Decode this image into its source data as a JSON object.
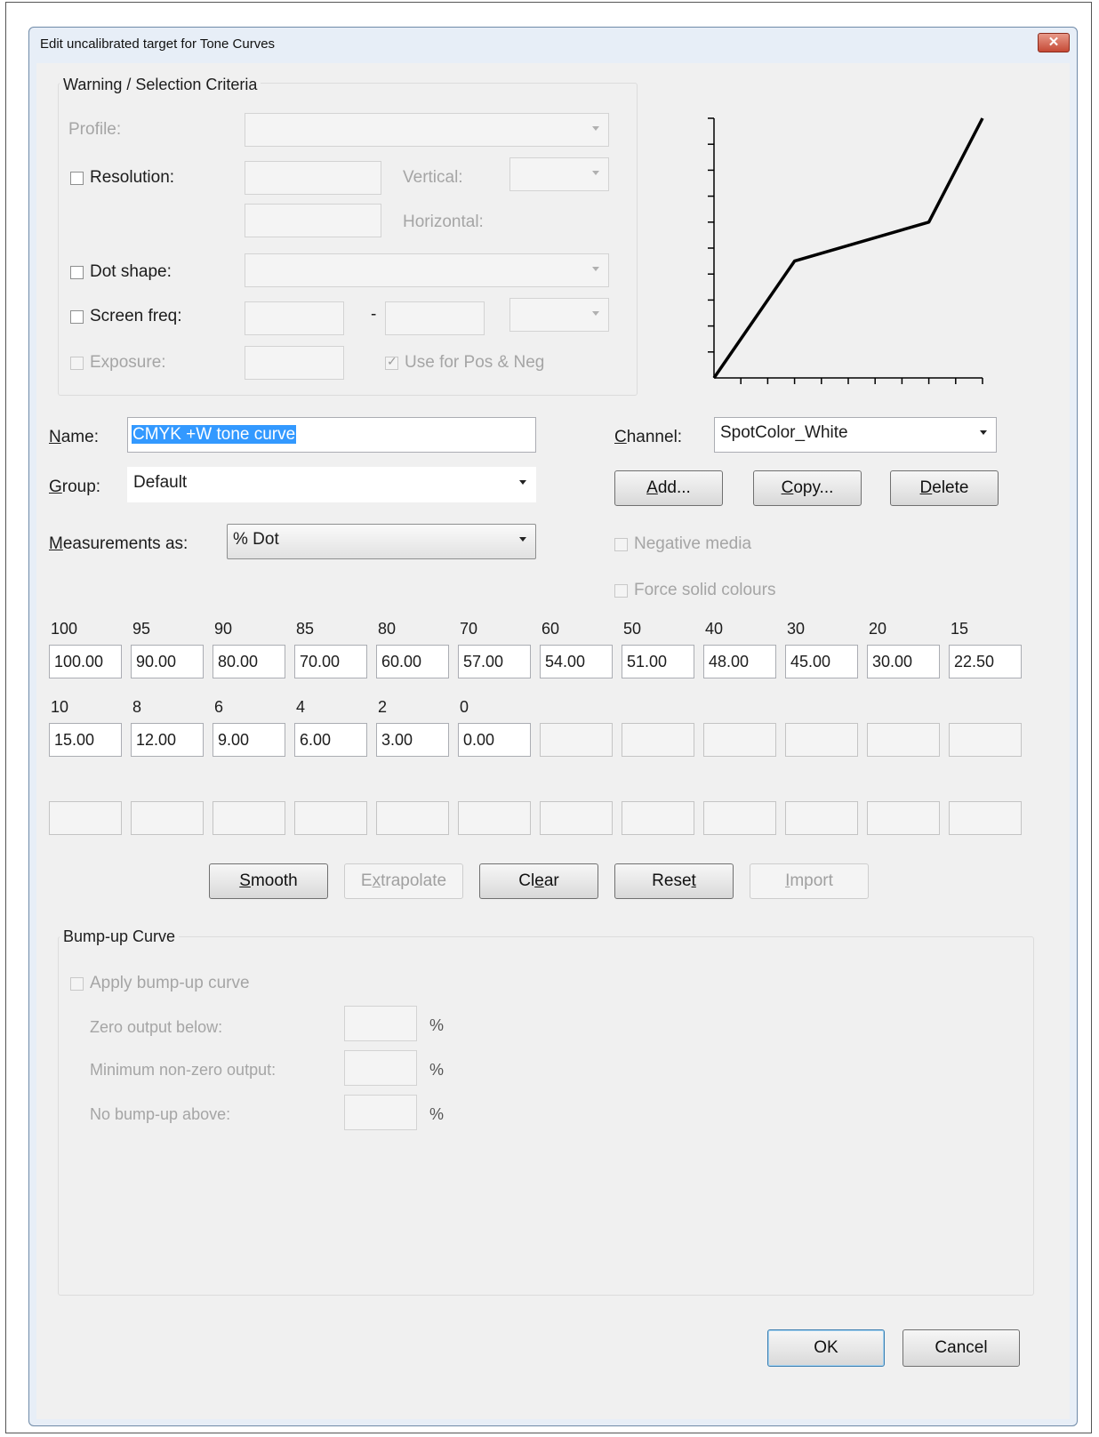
{
  "window": {
    "title": "Edit uncalibrated target for Tone Curves",
    "close_symbol": "✕"
  },
  "warning": {
    "title": "Warning / Selection Criteria",
    "profile_label": "Profile:",
    "resolution_label": "Resolution:",
    "vertical_label": "Vertical:",
    "horizontal_label": "Horizontal:",
    "dot_shape_label": "Dot shape:",
    "screen_freq_label": "Screen freq:",
    "screen_dash": "-",
    "exposure_label": "Exposure:",
    "use_pos_neg_label": "Use for Pos & Neg"
  },
  "chart_data": {
    "type": "line",
    "x": [
      0,
      30,
      80,
      100
    ],
    "y": [
      0,
      45,
      60,
      100
    ],
    "xlim": [
      0,
      100
    ],
    "ylim": [
      0,
      100
    ],
    "x_ticks": 10,
    "y_ticks": 10,
    "line_color": "#000000"
  },
  "form": {
    "name_label": "Name:",
    "name_value": "CMYK +W tone curve",
    "group_label": "Group:",
    "group_value": "Default",
    "measurements_label": "Measurements as:",
    "measurements_value": "% Dot",
    "channel_label": "Channel:",
    "channel_value": "SpotColor_White"
  },
  "buttons": {
    "add": "Add...",
    "copy": "Copy...",
    "delete": "Delete",
    "smooth": "Smooth",
    "extrapolate": "Extrapolate",
    "clear": "Clear",
    "reset": "Reset",
    "import": "Import",
    "ok": "OK",
    "cancel": "Cancel"
  },
  "options": {
    "negative_media": "Negative media",
    "force_solid": "Force solid colours"
  },
  "grid": {
    "row1_headers": [
      "100",
      "95",
      "90",
      "85",
      "80",
      "70",
      "60",
      "50",
      "40",
      "30",
      "20",
      "15"
    ],
    "row1_values": [
      "100.00",
      "90.00",
      "80.00",
      "70.00",
      "60.00",
      "57.00",
      "54.00",
      "51.00",
      "48.00",
      "45.00",
      "30.00",
      "22.50"
    ],
    "row2_headers": [
      "10",
      "8",
      "6",
      "4",
      "2",
      "0"
    ],
    "row2_values": [
      "15.00",
      "12.00",
      "9.00",
      "6.00",
      "3.00",
      "0.00"
    ]
  },
  "bump": {
    "title": "Bump-up Curve",
    "apply_label": "Apply bump-up curve",
    "zero_label": "Zero output below:",
    "min_label": "Minimum non-zero output:",
    "no_bump_label": "No bump-up above:",
    "percent": "%"
  }
}
